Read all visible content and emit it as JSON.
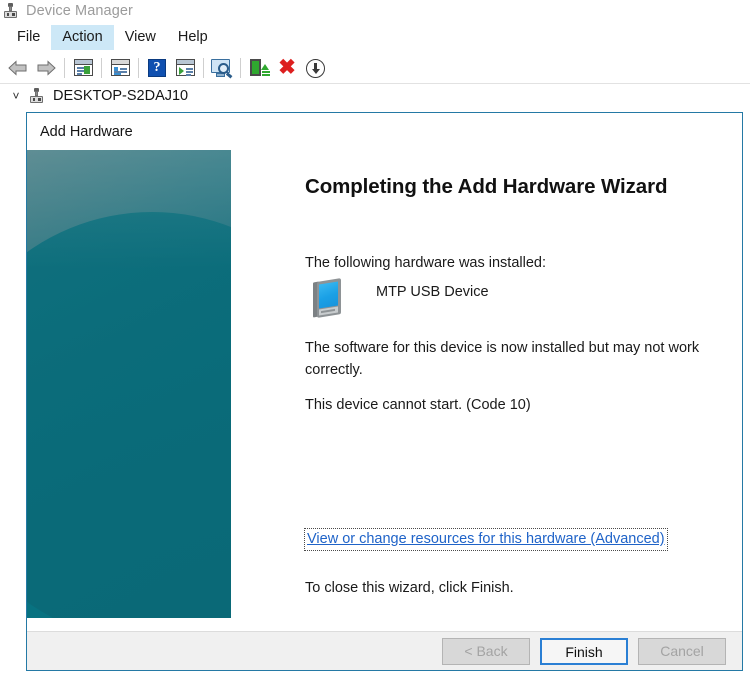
{
  "window": {
    "title": "Device Manager",
    "title_icon": "computer-device-icon",
    "menu": [
      {
        "label": "File",
        "active": false
      },
      {
        "label": "Action",
        "active": true
      },
      {
        "label": "View",
        "active": false
      },
      {
        "label": "Help",
        "active": false
      }
    ],
    "toolbar": [
      {
        "name": "back-arrow-icon",
        "type": "arrow-back"
      },
      {
        "name": "forward-arrow-icon",
        "type": "arrow-forward"
      },
      {
        "name": "separator-1",
        "type": "separator"
      },
      {
        "name": "properties-icon",
        "type": "window-green"
      },
      {
        "name": "separator-2",
        "type": "separator"
      },
      {
        "name": "show-details-icon",
        "type": "window-blue"
      },
      {
        "name": "separator-3",
        "type": "separator"
      },
      {
        "name": "help-icon",
        "type": "help",
        "glyph": "?"
      },
      {
        "name": "update-device-icon",
        "type": "window-play"
      },
      {
        "name": "separator-4",
        "type": "separator"
      },
      {
        "name": "scan-hardware-changes-icon",
        "type": "scan"
      },
      {
        "name": "separator-5",
        "type": "separator"
      },
      {
        "name": "update-driver-icon",
        "type": "driver-update"
      },
      {
        "name": "uninstall-device-icon",
        "type": "red-x",
        "glyph": "✖"
      },
      {
        "name": "disable-device-icon",
        "type": "download-arrow"
      }
    ],
    "tree": {
      "expander": "˅",
      "icon": "computer-device-icon",
      "label": "DESKTOP-S2DAJ10"
    }
  },
  "dialog": {
    "title": "Add Hardware",
    "heading": "Completing the Add Hardware Wizard",
    "installed_label": "The following hardware was installed:",
    "device_icon": "portable-media-device-icon",
    "device_name": "MTP USB Device",
    "status_line_1": "The software for this device is now installed but may not work correctly.",
    "status_line_2": "This device cannot start. (Code 10)",
    "advanced_link": "View or change resources for this hardware (Advanced)",
    "close_text": "To close this wizard, click Finish.",
    "buttons": [
      {
        "label": "< Back",
        "name": "back-button",
        "state": "disabled"
      },
      {
        "label": "Finish",
        "name": "finish-button",
        "state": "default"
      },
      {
        "label": "Cancel",
        "name": "cancel-button",
        "state": "disabled"
      }
    ]
  },
  "colors": {
    "banner_teal": "#0b6d7c",
    "dialog_border": "#2479a5",
    "link_blue": "#1f63c8",
    "menu_highlight": "#cde8f7",
    "default_button_border": "#2a7fd4",
    "error_red": "#dd1f1f"
  }
}
